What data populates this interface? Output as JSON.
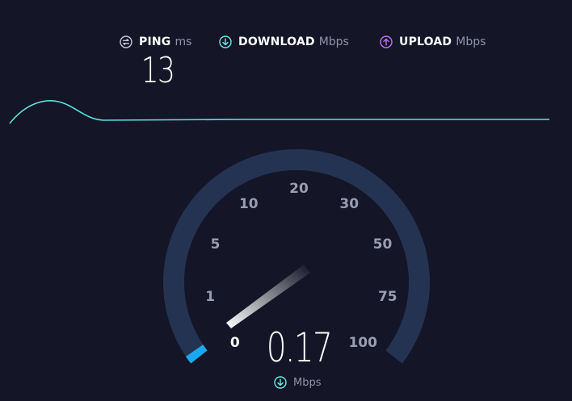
{
  "header": {
    "ping": {
      "label": "PING",
      "unit": "ms",
      "icon": "ping-icon"
    },
    "download": {
      "label": "DOWNLOAD",
      "unit": "Mbps",
      "icon": "download-arrow-icon"
    },
    "upload": {
      "label": "UPLOAD",
      "unit": "Mbps",
      "icon": "upload-arrow-icon"
    }
  },
  "ping_value": "13",
  "gauge": {
    "scale_labels": [
      "0",
      "1",
      "5",
      "10",
      "20",
      "30",
      "50",
      "75",
      "100"
    ],
    "active_label_index": 0,
    "current_reading": "0.17",
    "reading_unit": "Mbps",
    "reading_icon": "download-arrow-icon",
    "progress_fraction": 0.003
  },
  "colors": {
    "background": "#141526",
    "gauge_track": "#243352",
    "gauge_progress": "#1aa8f0",
    "download_accent": "#6fe8e6",
    "upload_accent": "#bf71ff",
    "graph_line": "#5fe0e4",
    "label_muted": "#9a9db2"
  }
}
